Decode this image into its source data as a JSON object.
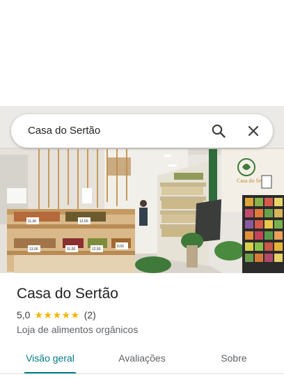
{
  "search": {
    "query": "Casa do Sertão"
  },
  "place": {
    "title": "Casa do Sertão",
    "rating": "5,0",
    "stars": "★★★★★",
    "reviews_count": "(2)",
    "category": "Loja de alimentos orgânicos"
  },
  "tabs": [
    {
      "label": "Visão geral",
      "active": true
    },
    {
      "label": "Avaliações",
      "active": false
    },
    {
      "label": "Sobre",
      "active": false
    }
  ],
  "photo": {
    "price_tags": [
      "11,00",
      "12,50",
      "13,00",
      "11,00",
      "12,50",
      "9,00"
    ],
    "store_sign": "Casa do Sertão"
  },
  "colors": {
    "accent": "#007b83",
    "star": "#f4b400",
    "text_primary": "#202124"
  }
}
